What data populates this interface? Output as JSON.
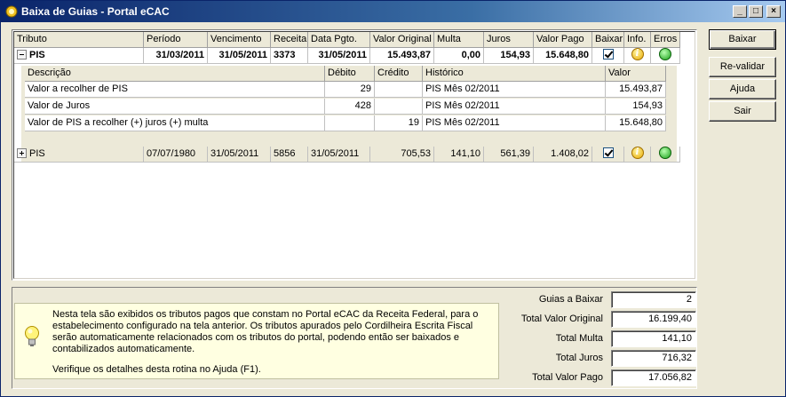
{
  "window": {
    "title": "Baixa de Guias - Portal eCAC"
  },
  "grid": {
    "columns": [
      "Tributo",
      "Período",
      "Vencimento",
      "Receita",
      "Data Pgto.",
      "Valor Original",
      "Multa",
      "Juros",
      "Valor Pago",
      "Baixar",
      "Info.",
      "Erros"
    ],
    "rows": [
      {
        "tributo": "PIS",
        "periodo": "31/03/2011",
        "vencimento": "31/05/2011",
        "receita": "3373",
        "data_pgto": "31/05/2011",
        "valor_original": "15.493,87",
        "multa": "0,00",
        "juros": "154,93",
        "valor_pago": "15.648,80",
        "expanded": true
      },
      {
        "tributo": "PIS",
        "periodo": "07/07/1980",
        "vencimento": "31/05/2011",
        "receita": "5856",
        "data_pgto": "31/05/2011",
        "valor_original": "705,53",
        "multa": "141,10",
        "juros": "561,39",
        "valor_pago": "1.408,02",
        "expanded": false
      }
    ],
    "detail": {
      "columns": [
        "Descrição",
        "Débito",
        "Crédito",
        "Histórico",
        "Valor"
      ],
      "rows": [
        {
          "descricao": "Valor a recolher de PIS",
          "debito": "29",
          "credito": "",
          "historico": "PIS Mês 02/2011",
          "valor": "15.493,87"
        },
        {
          "descricao": "Valor de Juros",
          "debito": "428",
          "credito": "",
          "historico": "PIS Mês 02/2011",
          "valor": "154,93"
        },
        {
          "descricao": "Valor de PIS a recolher (+) juros (+) multa",
          "debito": "",
          "credito": "19",
          "historico": "PIS Mês 02/2011",
          "valor": "15.648,80"
        }
      ]
    }
  },
  "buttons": {
    "baixar": "Baixar",
    "revalidar": "Re-validar",
    "ajuda": "Ajuda",
    "sair": "Sair"
  },
  "hint": {
    "paragraph1": "Nesta tela são exibidos os tributos pagos que constam no Portal eCAC da Receita Federal, para o estabelecimento configurado na tela anterior. Os tributos apurados pelo Cordilheira Escrita Fiscal serão automaticamente relacionados com os tributos do portal, podendo então ser baixados e contabilizados automaticamente.",
    "paragraph2": "Verifique os detalhes desta rotina no Ajuda (F1)."
  },
  "totals": [
    {
      "label": "Guias a Baixar",
      "value": "2"
    },
    {
      "label": "Total Valor Original",
      "value": "16.199,40"
    },
    {
      "label": "Total Multa",
      "value": "141,10"
    },
    {
      "label": "Total Juros",
      "value": "716,32"
    },
    {
      "label": "Total Valor Pago",
      "value": "17.056,82"
    }
  ],
  "colors": {
    "title_start": "#0a246a",
    "title_end": "#a6caf0",
    "hint_bg": "#ffffe1",
    "ok_status": "#18a018",
    "info": "#e8a800"
  }
}
